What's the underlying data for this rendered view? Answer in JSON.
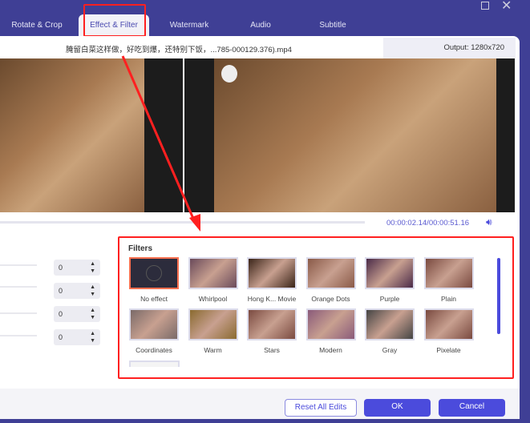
{
  "tabs": [
    "Rotate & Crop",
    "Effect & Filter",
    "Watermark",
    "Audio",
    "Subtitle"
  ],
  "active_tab": "Effect & Filter",
  "file_name": "腌留白菜这样做，好吃到爆，还特别下饭，...785-000129.376).mp4",
  "output": "Output: 1280x720",
  "time": "00:00:02.14/00:00:51.16",
  "adjust_values": [
    "0",
    "0",
    "0",
    "0"
  ],
  "filters_title": "Filters",
  "filters": [
    "No effect",
    "Whirlpool",
    "Hong K... Movie",
    "Orange Dots",
    "Purple",
    "Plain",
    "Coordinates",
    "Warm",
    "Stars",
    "Modern",
    "Gray",
    "Pixelate"
  ],
  "buttons": {
    "reset": "Reset All Edits",
    "ok": "OK",
    "cancel": "Cancel"
  },
  "colors": {
    "header": "#3f3f95",
    "accent": "#4b4bdc",
    "highlight": "#ff2020"
  }
}
